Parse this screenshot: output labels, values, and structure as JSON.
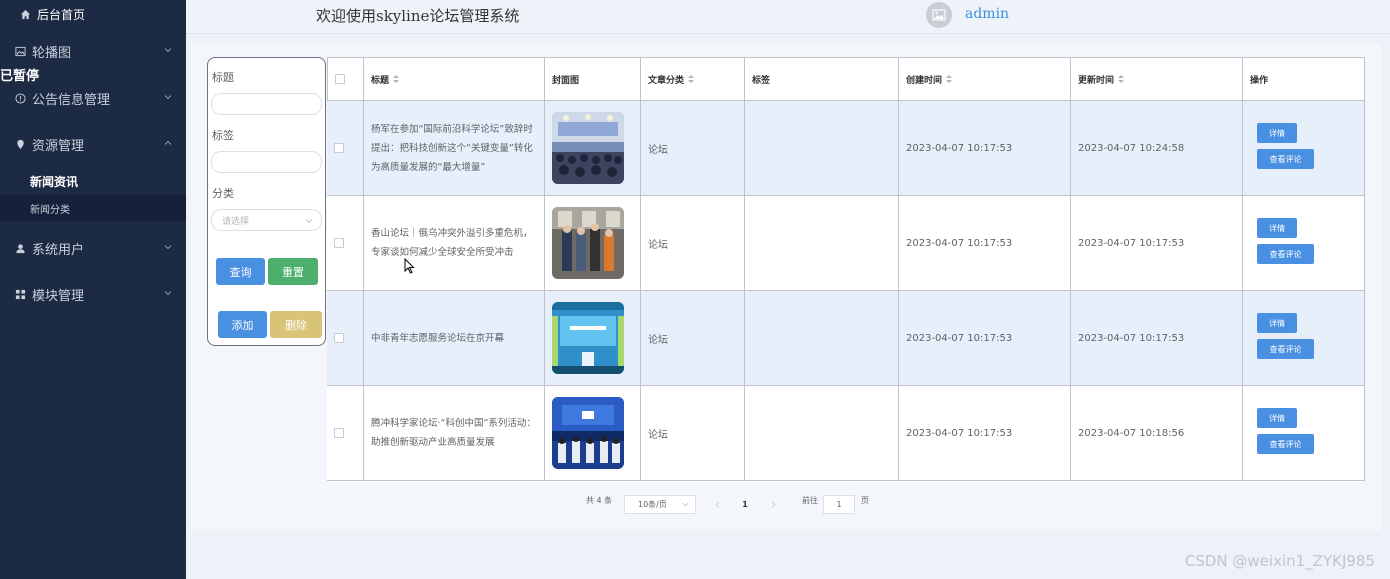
{
  "sidebar": {
    "home": "后台首页",
    "items": [
      {
        "label": "轮播图",
        "icon": "image-icon"
      },
      {
        "label": "公告信息管理",
        "icon": "info-icon"
      },
      {
        "label": "资源管理",
        "icon": "location-icon"
      },
      {
        "label": "系统用户",
        "icon": "user-icon"
      },
      {
        "label": "模块管理",
        "icon": "grid-icon"
      }
    ],
    "sub_items": [
      {
        "label": "新闻资讯"
      },
      {
        "label": "新闻分类"
      }
    ],
    "overlay_text": "已暂停"
  },
  "header": {
    "welcome": "欢迎使用skyline论坛管理系统",
    "user": "admin"
  },
  "search": {
    "title_label": "标题",
    "tag_label": "标签",
    "category_label": "分类",
    "category_placeholder": "请选择",
    "query_button": "查询",
    "reset_button": "重置",
    "add_button": "添加",
    "delete_button": "删除"
  },
  "table": {
    "headers": {
      "title": "标题",
      "cover": "封面图",
      "category": "文章分类",
      "tags": "标签",
      "created": "创建时间",
      "updated": "更新时间",
      "actions": "操作"
    },
    "detail_label": "详情",
    "comments_label": "查看评论",
    "rows": [
      {
        "title": "杨军在参加“国际前沿科学论坛”致辞时提出：把科技创新这个“关键变量”转化为高质量发展的“最大增量”",
        "category": "论坛",
        "tags": "",
        "created": "2023-04-07 10:17:53",
        "updated": "2023-04-07 10:24:58"
      },
      {
        "title": "香山论坛｜俄乌冲突外溢引多重危机，专家谈如何减少全球安全所受冲击",
        "category": "论坛",
        "tags": "",
        "created": "2023-04-07 10:17:53",
        "updated": "2023-04-07 10:17:53"
      },
      {
        "title": "中非青年志愿服务论坛在京开幕",
        "category": "论坛",
        "tags": "",
        "created": "2023-04-07 10:17:53",
        "updated": "2023-04-07 10:17:53"
      },
      {
        "title": "腾冲科学家论坛·“科创中国”系列活动：助推创新驱动产业高质量发展",
        "category": "论坛",
        "tags": "",
        "created": "2023-04-07 10:17:53",
        "updated": "2023-04-07 10:18:56"
      }
    ]
  },
  "pagination": {
    "total": "共 4 条",
    "page_size": "10条/页",
    "current_page": "1",
    "goto_label": "前往",
    "goto_value": "1",
    "page_suffix": "页"
  },
  "watermark": "CSDN @weixin1_ZYKJ985",
  "colors": {
    "sidebar_bg": "#1c2a44",
    "primary": "#4a90e2",
    "success": "#4caf6e",
    "warning": "#d9c377",
    "row_highlight": "#e6effa"
  }
}
